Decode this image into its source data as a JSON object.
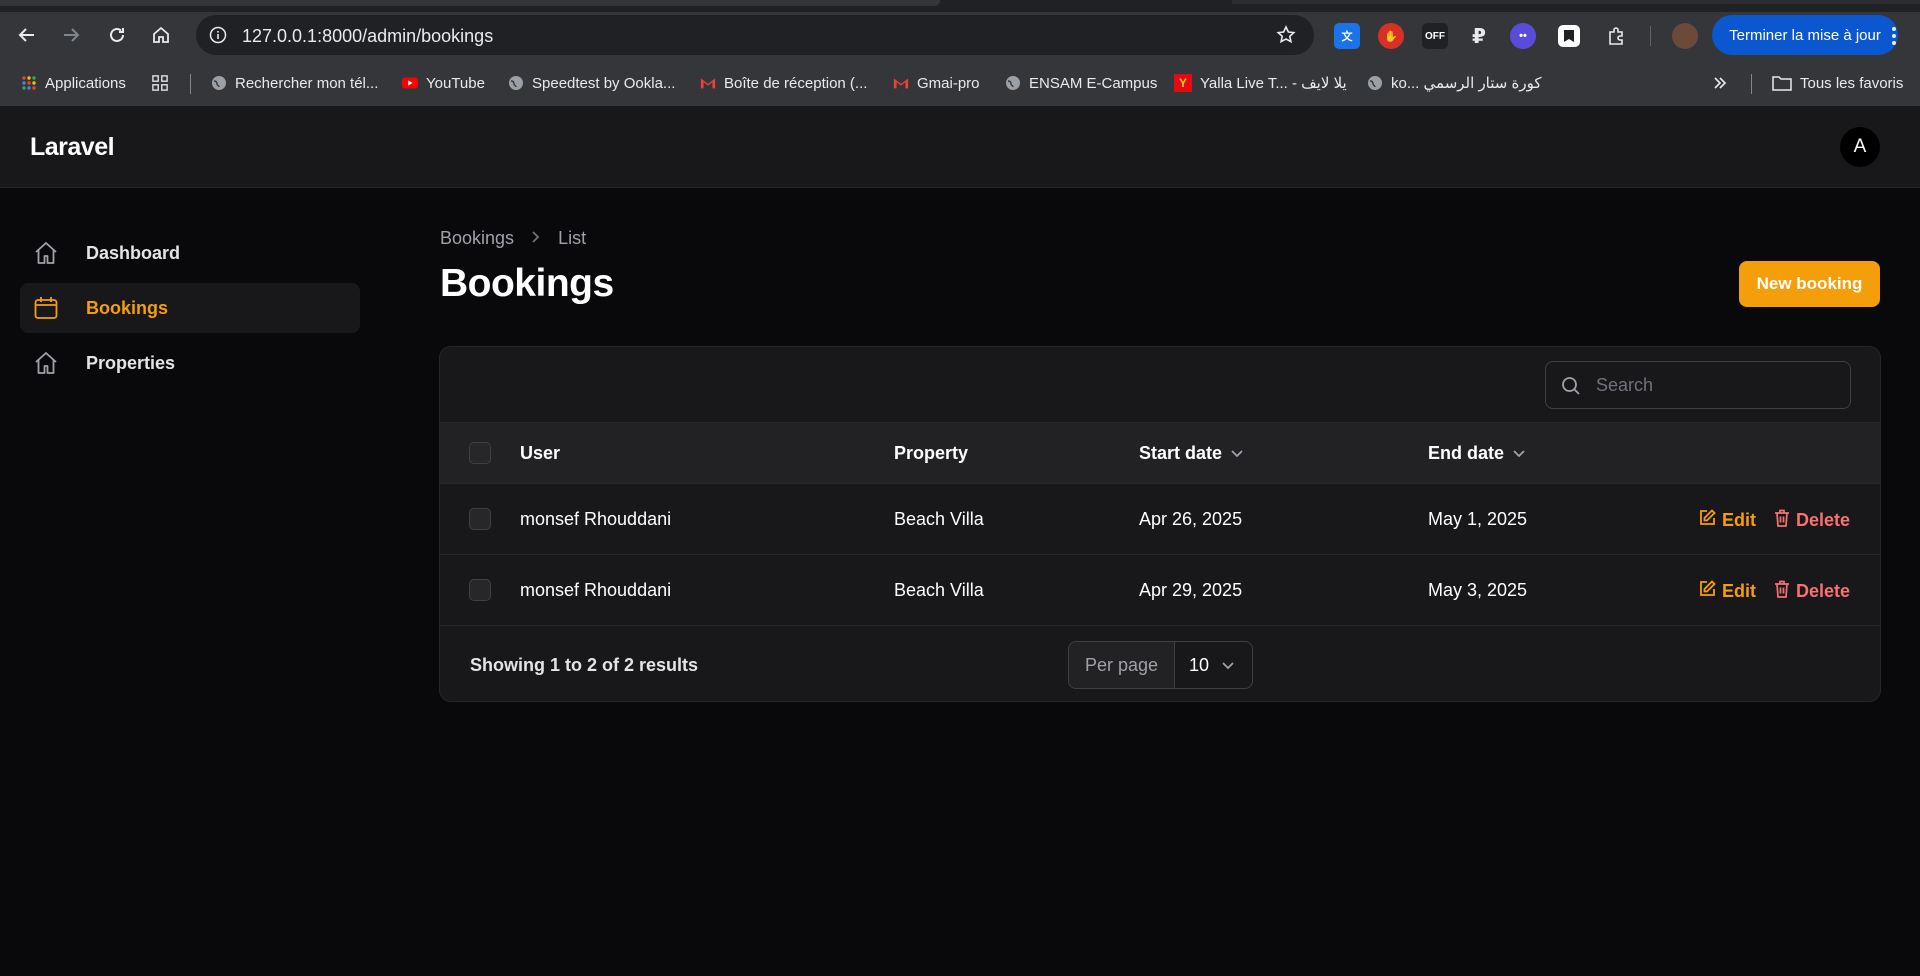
{
  "browser": {
    "url": "127.0.0.1:8000/admin/bookings",
    "update_button": "Terminer la mise à jour",
    "extensions": [
      {
        "name": "translate-extension-icon",
        "label": "",
        "bg": "#1a73e8"
      },
      {
        "name": "adblock-extension-icon",
        "label": "",
        "bg": "#d93025"
      },
      {
        "name": "off-extension-icon",
        "label": "OFF",
        "bg": "#202124"
      },
      {
        "name": "ruble-extension-icon",
        "label": "₽",
        "bg": "transparent"
      },
      {
        "name": "ghost-extension-icon",
        "label": "",
        "bg": "#5b4bdb"
      },
      {
        "name": "bookmark-extension-icon",
        "label": "",
        "bg": "#ffffff"
      },
      {
        "name": "puzzle-extensions-icon",
        "label": "",
        "bg": "transparent"
      }
    ],
    "bookmarks": [
      {
        "label": "Applications",
        "icon": "apps-grid-icon"
      },
      {
        "label": "",
        "icon": "grid-icon"
      },
      {
        "label": "Rechercher mon tél...",
        "icon": "globe-icon"
      },
      {
        "label": "YouTube",
        "icon": "youtube-icon"
      },
      {
        "label": "Speedtest by Ookla...",
        "icon": "globe-icon"
      },
      {
        "label": "Boîte de réception (...",
        "icon": "gmail-icon"
      },
      {
        "label": "Gmai-pro",
        "icon": "gmail-icon"
      },
      {
        "label": "ENSAM E-Campus",
        "icon": "globe-icon"
      },
      {
        "label": "Yalla Live T... - يلا لايف",
        "icon": "yalla-icon"
      },
      {
        "label": "ko... كورة ستار الرسمي",
        "icon": "globe-icon"
      }
    ],
    "all_bookmarks": "Tous les favoris"
  },
  "app": {
    "brand": "Laravel",
    "avatar_initial": "A"
  },
  "sidebar": {
    "items": [
      {
        "label": "Dashboard",
        "icon": "home-icon",
        "active": false
      },
      {
        "label": "Bookings",
        "icon": "calendar-icon",
        "active": true
      },
      {
        "label": "Properties",
        "icon": "home-icon",
        "active": false
      }
    ]
  },
  "page": {
    "breadcrumb": [
      "Bookings",
      "List"
    ],
    "title": "Bookings",
    "new_button": "New booking"
  },
  "table": {
    "search_placeholder": "Search",
    "columns": [
      "User",
      "Property",
      "Start date",
      "End date"
    ],
    "rows": [
      {
        "user": "monsef Rhouddani",
        "property": "Beach Villa",
        "start": "Apr 26, 2025",
        "end": "May 1, 2025"
      },
      {
        "user": "monsef Rhouddani",
        "property": "Beach Villa",
        "start": "Apr 29, 2025",
        "end": "May 3, 2025"
      }
    ],
    "edit_label": "Edit",
    "delete_label": "Delete",
    "results_text": "Showing 1 to 2 of 2 results",
    "per_page_label": "Per page",
    "per_page_value": "10"
  },
  "colors": {
    "accent": "#f59e0b",
    "danger": "#f87171",
    "background": "#09090b",
    "surface": "#18181b"
  }
}
